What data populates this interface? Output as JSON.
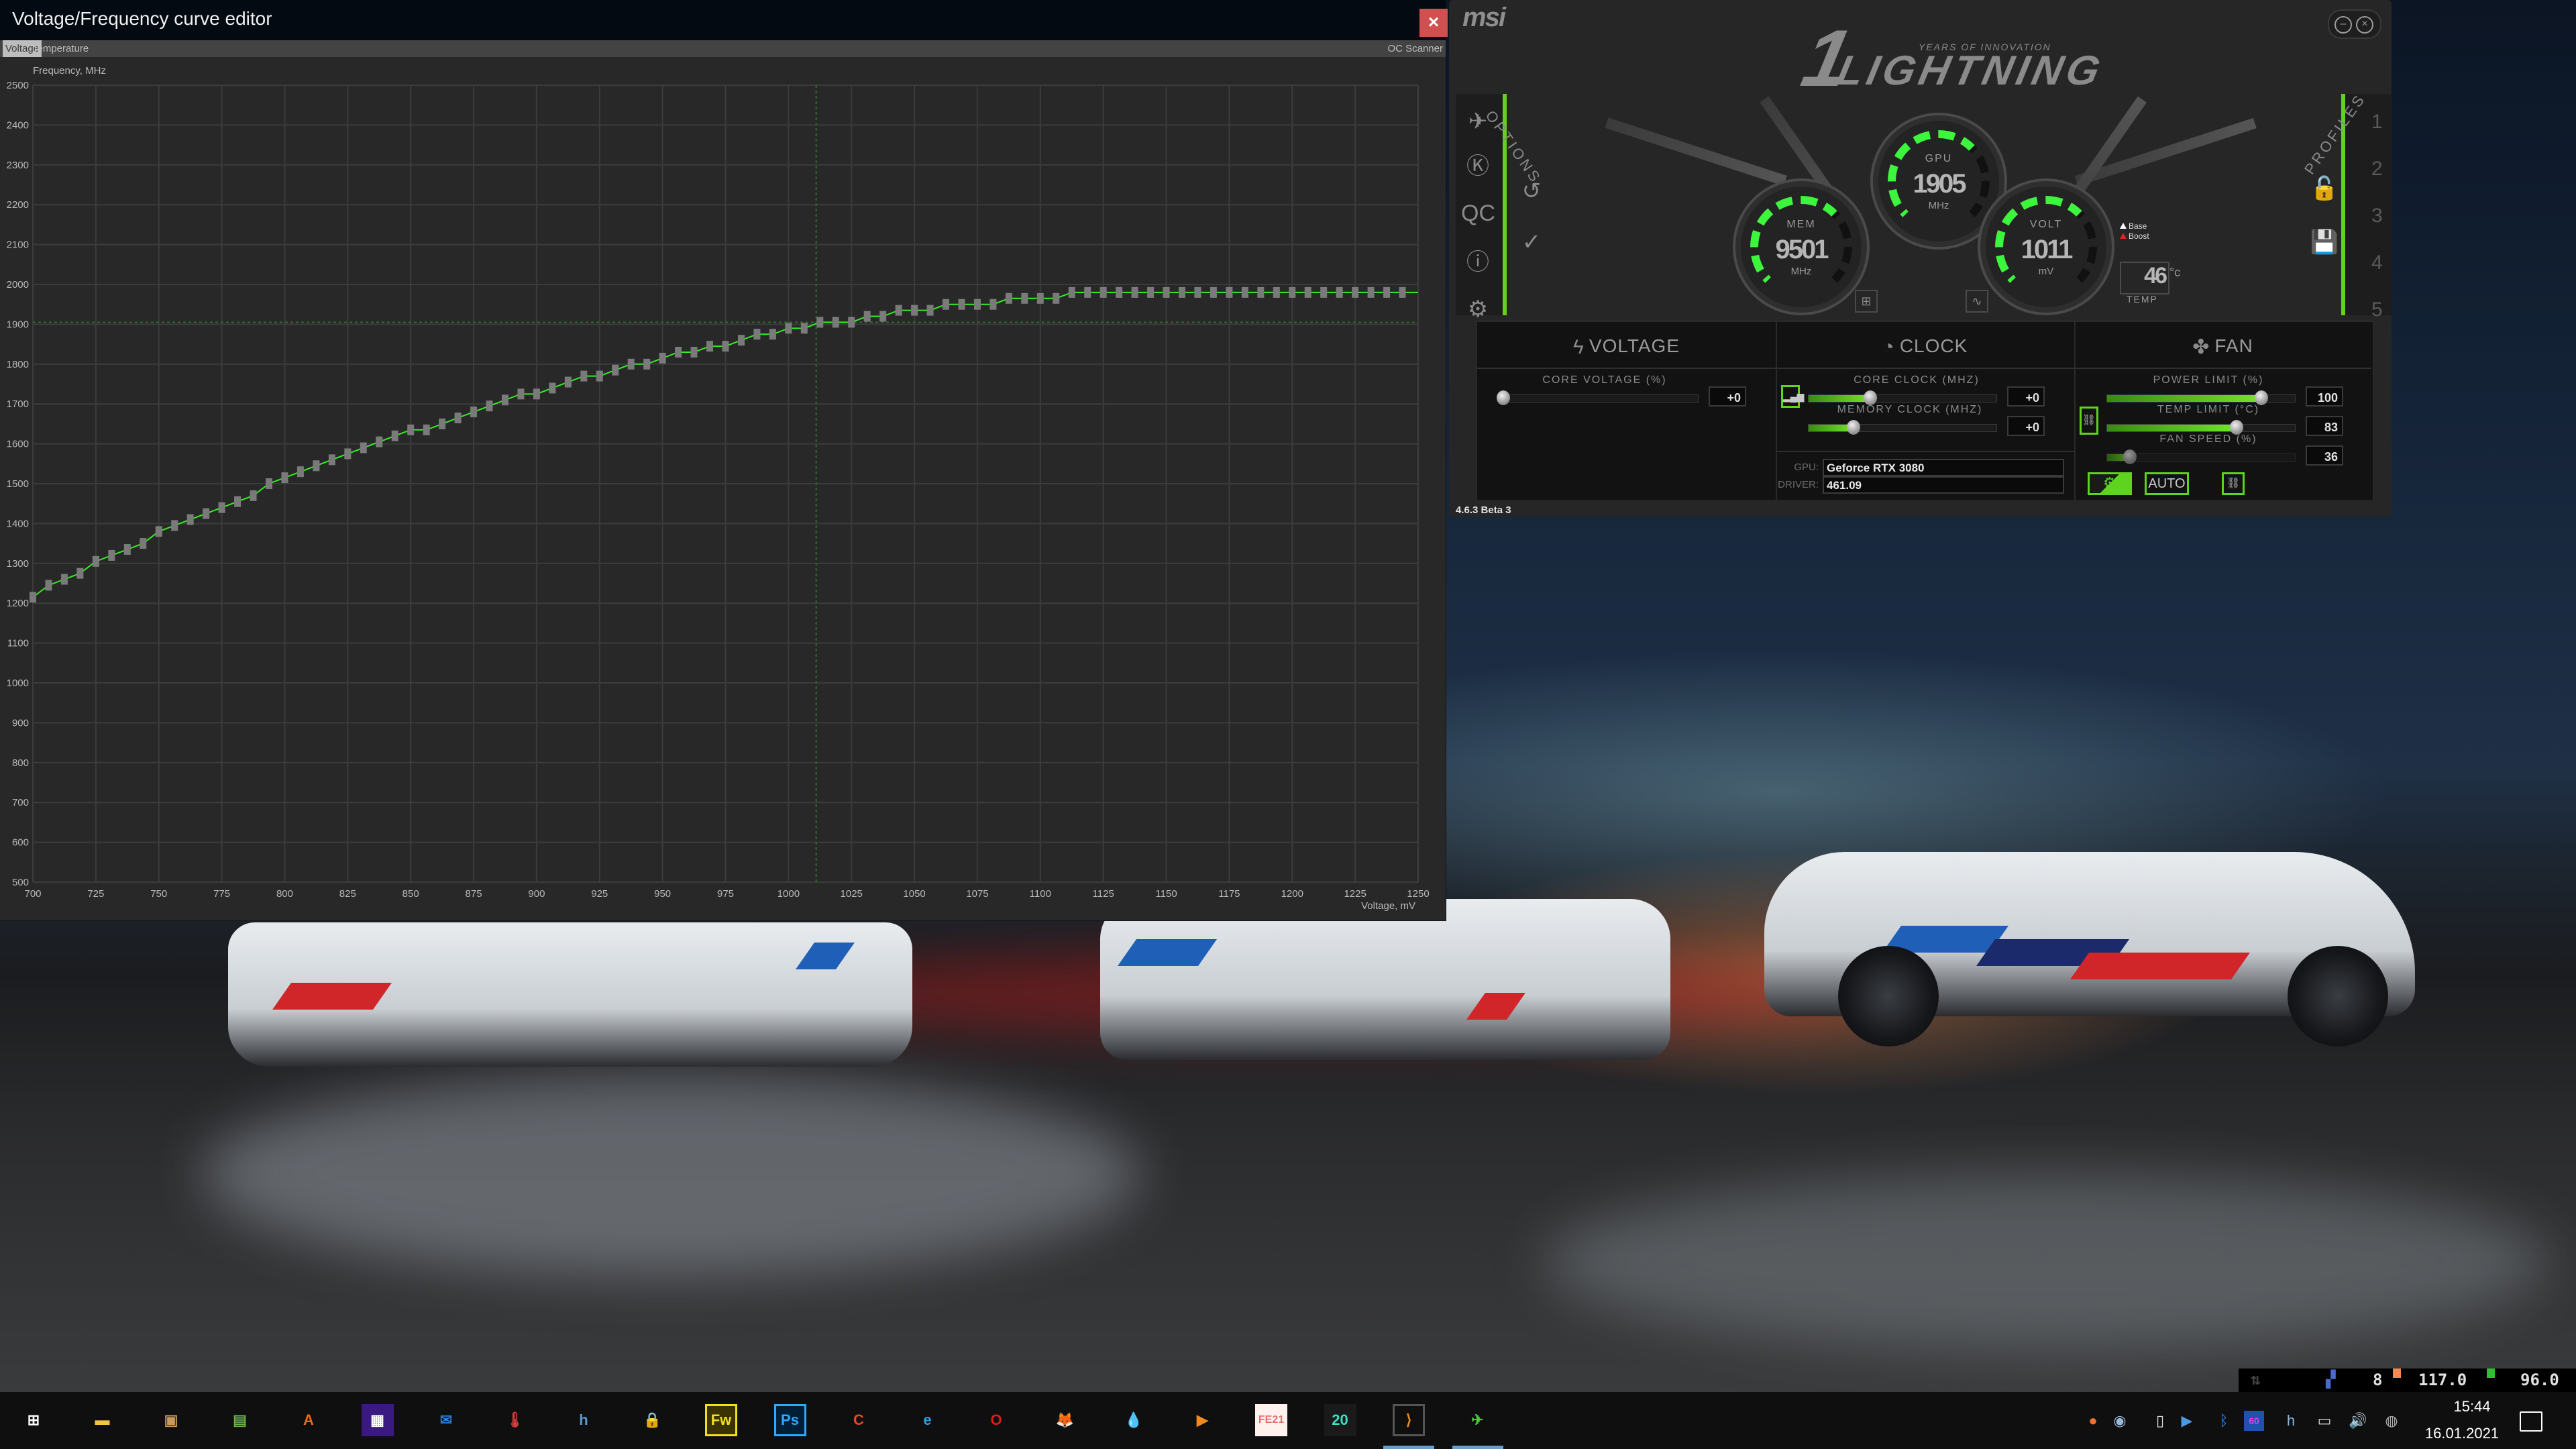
{
  "vf_editor": {
    "title": "Voltage/Frequency curve editor",
    "close_label": "×",
    "tabs": [
      {
        "label": "Voltage",
        "active": true
      },
      {
        "label": "Temperature",
        "active": false
      }
    ],
    "oc_scanner_label": "OC Scanner"
  },
  "chart_data": {
    "type": "line",
    "title": "",
    "ylabel": "Frequency, MHz",
    "xlabel": "Voltage, mV",
    "xlim": [
      700,
      1250
    ],
    "ylim": [
      500,
      2500
    ],
    "x_ticks": [
      700,
      725,
      750,
      775,
      800,
      825,
      850,
      875,
      900,
      925,
      950,
      975,
      1000,
      1025,
      1050,
      1075,
      1100,
      1125,
      1150,
      1175,
      1200,
      1225,
      1250
    ],
    "y_ticks": [
      500,
      600,
      700,
      800,
      900,
      1000,
      1100,
      1200,
      1300,
      1400,
      1500,
      1600,
      1700,
      1800,
      1900,
      2000,
      2100,
      2200,
      2300,
      2400,
      2500
    ],
    "grid": true,
    "current_voltage_mv": 1011,
    "current_frequency_mhz": 1905,
    "line_color": "#33ee22",
    "point_color": "#7a7a7a",
    "series": [
      {
        "name": "V/F curve",
        "x": [
          700,
          706.25,
          712.5,
          718.75,
          725,
          731.25,
          737.5,
          743.75,
          750,
          756.25,
          762.5,
          768.75,
          775,
          781.25,
          787.5,
          793.75,
          800,
          806.25,
          812.5,
          818.75,
          825,
          831.25,
          837.5,
          843.75,
          850,
          856.25,
          862.5,
          868.75,
          875,
          881.25,
          887.5,
          893.75,
          900,
          906.25,
          912.5,
          918.75,
          925,
          931.25,
          937.5,
          943.75,
          950,
          956.25,
          962.5,
          968.75,
          975,
          981.25,
          987.5,
          993.75,
          1000,
          1006.25,
          1012.5,
          1018.75,
          1025,
          1031.25,
          1037.5,
          1043.75,
          1050,
          1056.25,
          1062.5,
          1068.75,
          1075,
          1081.25,
          1087.5,
          1093.75,
          1100,
          1106.25,
          1112.5,
          1118.75,
          1125,
          1131.25,
          1137.5,
          1143.75,
          1150,
          1156.25,
          1162.5,
          1168.75,
          1175,
          1181.25,
          1187.5,
          1193.75,
          1200,
          1206.25,
          1212.5,
          1218.75,
          1225,
          1231.25,
          1237.5,
          1243.75
        ],
        "y": [
          1215,
          1245,
          1260,
          1275,
          1305,
          1320,
          1335,
          1350,
          1380,
          1395,
          1410,
          1425,
          1440,
          1455,
          1470,
          1500,
          1515,
          1530,
          1545,
          1560,
          1575,
          1590,
          1605,
          1620,
          1635,
          1635,
          1650,
          1665,
          1680,
          1695,
          1710,
          1725,
          1725,
          1740,
          1755,
          1770,
          1770,
          1785,
          1800,
          1800,
          1815,
          1830,
          1830,
          1845,
          1845,
          1860,
          1875,
          1875,
          1890,
          1890,
          1905,
          1905,
          1905,
          1920,
          1920,
          1935,
          1935,
          1935,
          1950,
          1950,
          1950,
          1950,
          1965,
          1965,
          1965,
          1965,
          1980,
          1980,
          1980,
          1980,
          1980,
          1980,
          1980,
          1980,
          1980,
          1980,
          1980,
          1980,
          1980,
          1980,
          1980,
          1980,
          1980,
          1980,
          1980,
          1980,
          1980,
          1980
        ]
      }
    ]
  },
  "afterburner": {
    "logo": "msi",
    "brand_number": "1",
    "brand_tagline": "YEARS OF INNOVATION",
    "brand_name": "LIGHTNING",
    "options_label": "OPTIONS",
    "profiles_label": "PROFILES",
    "profile_numbers": [
      "1",
      "2",
      "3",
      "4",
      "5"
    ],
    "gauges": {
      "gpu": {
        "label": "GPU",
        "value": "1905",
        "unit": "MHz"
      },
      "mem": {
        "label": "MEM",
        "value": "9501",
        "unit": "MHz"
      },
      "volt": {
        "label": "VOLT",
        "value": "1011",
        "unit": "mV"
      }
    },
    "legend": {
      "base": "Base",
      "boost": "Boost"
    },
    "temp": {
      "value": "46",
      "unit": "°c",
      "label": "TEMP"
    },
    "sections": {
      "voltage": "VOLTAGE",
      "clock": "CLOCK",
      "fan": "FAN"
    },
    "controls": {
      "core_voltage": {
        "label": "CORE VOLTAGE (%)",
        "value": "+0",
        "fraction": 0.0
      },
      "core_clock": {
        "label": "CORE CLOCK (MHZ)",
        "value": "+0",
        "fraction": 0.33
      },
      "memory_clock": {
        "label": "MEMORY CLOCK (MHZ)",
        "value": "+0",
        "fraction": 0.24
      },
      "power_limit": {
        "label": "POWER LIMIT (%)",
        "value": "100",
        "fraction": 0.82
      },
      "temp_limit": {
        "label": "TEMP LIMIT (°C)",
        "value": "83",
        "fraction": 0.69
      },
      "fan_speed": {
        "label": "FAN SPEED (%)",
        "value": "36",
        "fraction": 0.12
      }
    },
    "info": {
      "gpu_label": "GPU:",
      "gpu_value": "Geforce RTX 3080",
      "driver_label": "DRIVER:",
      "driver_value": "461.09"
    },
    "fan_auto_label": "AUTO",
    "version": "4.6.3 Beta 3",
    "accent_color": "#5ed41e"
  },
  "taskbar": {
    "apps": [
      {
        "name": "start",
        "glyph": "⊞",
        "running": false
      },
      {
        "name": "file-explorer",
        "glyph": "▬",
        "running": false
      },
      {
        "name": "photo-app",
        "glyph": "▣",
        "running": false
      },
      {
        "name": "gpu-z",
        "glyph": "▤",
        "running": false
      },
      {
        "name": "aida64",
        "glyph": "A",
        "running": false
      },
      {
        "name": "cpu-z",
        "glyph": "▦",
        "running": false
      },
      {
        "name": "thunderbird",
        "glyph": "✉",
        "running": false
      },
      {
        "name": "hwmonitor",
        "glyph": "🌡",
        "running": false
      },
      {
        "name": "hwinfo",
        "glyph": "h",
        "running": false
      },
      {
        "name": "keepass",
        "glyph": "🔒",
        "running": false
      },
      {
        "name": "fireworks",
        "glyph": "Fw",
        "running": false
      },
      {
        "name": "photoshop",
        "glyph": "Ps",
        "running": false
      },
      {
        "name": "ccleaner",
        "glyph": "C",
        "running": false
      },
      {
        "name": "edge",
        "glyph": "e",
        "running": false
      },
      {
        "name": "opera",
        "glyph": "O",
        "running": false
      },
      {
        "name": "firefox",
        "glyph": "🦊",
        "running": false
      },
      {
        "name": "rainmeter",
        "glyph": "💧",
        "running": false
      },
      {
        "name": "media-player",
        "glyph": "▶",
        "running": false
      },
      {
        "name": "fe21",
        "glyph": "FE21",
        "running": false
      },
      {
        "name": "live-editor",
        "glyph": "20",
        "running": false
      },
      {
        "name": "3dmark",
        "glyph": "⟩",
        "running": true
      },
      {
        "name": "msi-afterburner",
        "glyph": "✈",
        "running": true
      }
    ],
    "tray_overlay": {
      "value1": "8",
      "value2": "117.0",
      "value3": "96.0"
    },
    "tray_icons": [
      "origin",
      "steam",
      "usb",
      "network-share",
      "bluetooth",
      "rivatuner-60",
      "hwinfo",
      "network",
      "volume",
      "webcam"
    ],
    "rtss_label": "60",
    "clock_time": "15:44",
    "clock_date": "16.01.2021"
  }
}
